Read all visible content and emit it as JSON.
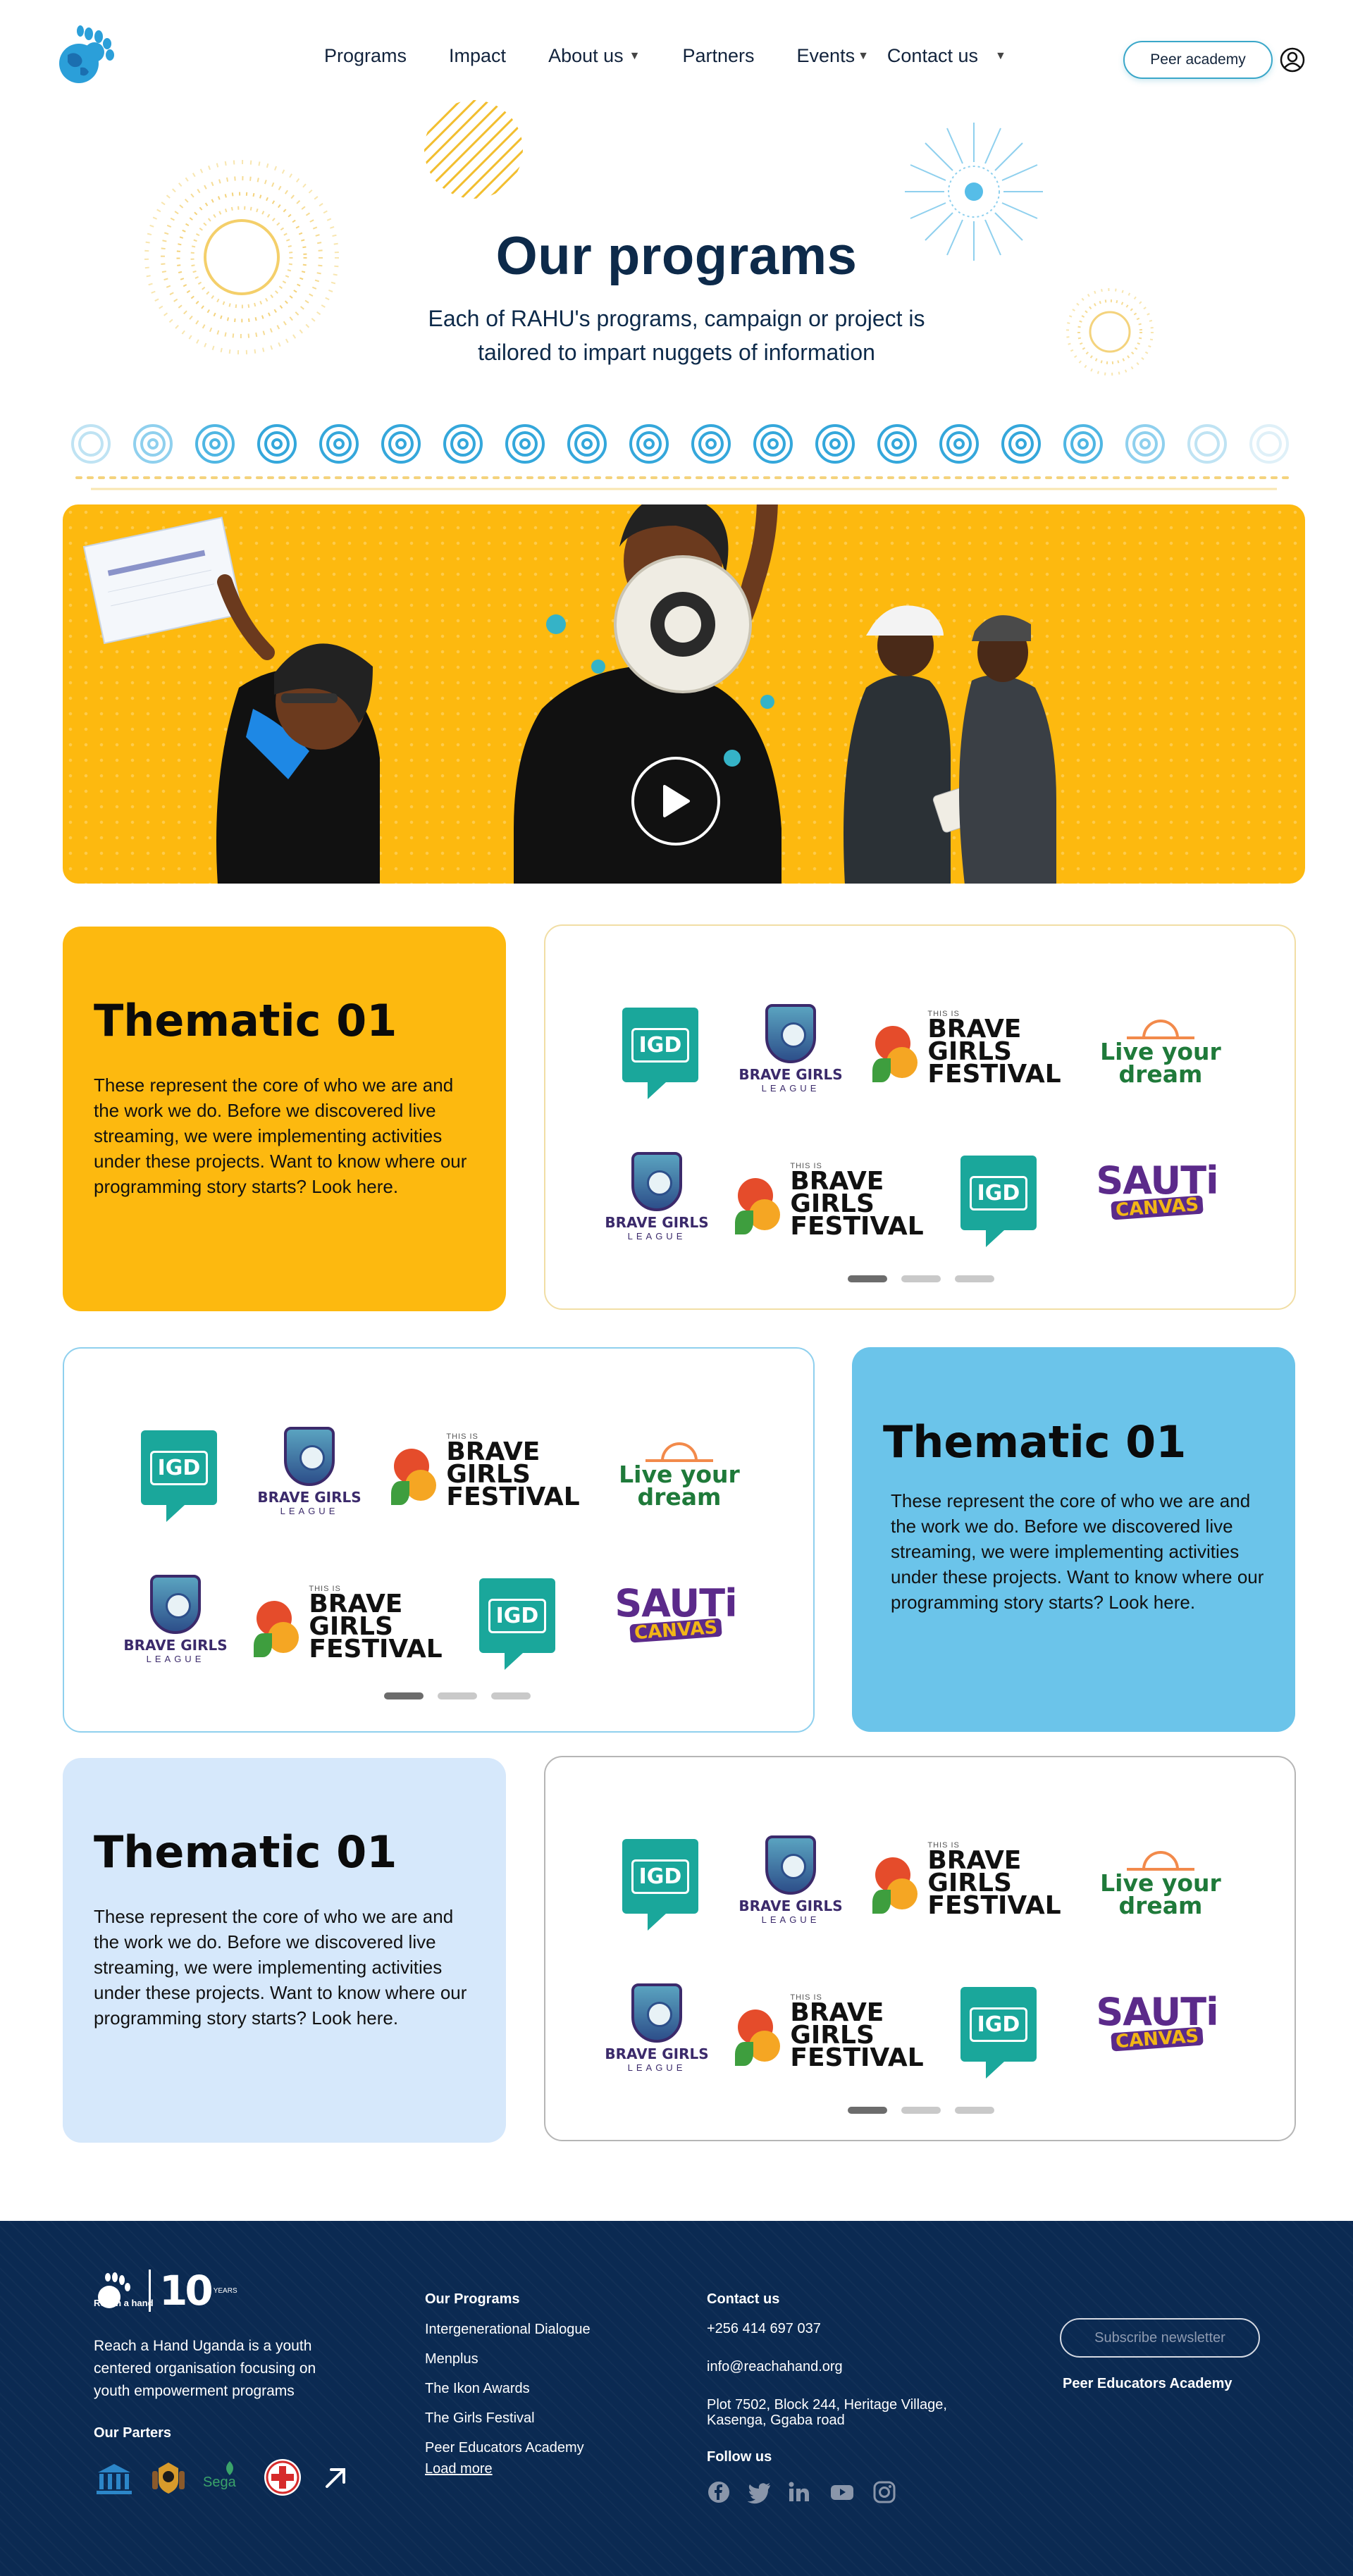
{
  "nav": {
    "items": [
      {
        "label": "Programs",
        "dropdown": false
      },
      {
        "label": "Impact",
        "dropdown": false
      },
      {
        "label": "About us",
        "dropdown": true
      },
      {
        "label": "Partners",
        "dropdown": false
      },
      {
        "label": "Events",
        "dropdown": true
      },
      {
        "label": "Contact us",
        "dropdown": true
      }
    ],
    "peer_button": "Peer academy",
    "logo_icon": "hand-globe-icon",
    "user_icon": "user-icon"
  },
  "hero": {
    "title": "Our programs",
    "subtitle": "Each of RAHU's programs, campaign or project is tailored to impart nuggets of information",
    "play_icon": "play-icon"
  },
  "sections": [
    {
      "title": "Thematic 01",
      "text": "These represent the core of who we are and the work we do. Before we discovered live streaming, we were implementing activities under these projects. Want to know where our programming story starts? Look here.",
      "color": "#fdb90f"
    },
    {
      "title": "Thematic 01",
      "text": "These represent the core of who we are and the work we do. Before we discovered live streaming, we were implementing activities under these projects. Want to know where our programming story starts? Look here.",
      "color": "#6bc4ea"
    },
    {
      "title": "Thematic 01",
      "text": "These represent the core of who we are and the work we do. Before we discovered live streaming, we were implementing activities under these projects. Want to know where our programming story starts? Look here.",
      "color": "#d6e8fb"
    }
  ],
  "logos": {
    "igd": "IGD",
    "bgl_line1": "BRAVE GIRLS",
    "bgl_line2": "LEAGUE",
    "bgf_small": "THIS IS",
    "bgf_l1": "BRAVE",
    "bgf_l2": "GIRLS",
    "bgf_l3": "FESTIVAL",
    "lyd_l1": "Live your",
    "lyd_l2": "dream",
    "sauti_l1": "SAUTi",
    "sauti_l2": "CANVAS"
  },
  "carousel": {
    "pages": 3,
    "active": 1
  },
  "footer": {
    "about": "Reach a Hand Uganda is a youth centered organisation focusing on youth empowerment programs",
    "logo_text": "Reach a hand",
    "anniversary": "10",
    "anniversary_tag": "YEARS",
    "partners_heading": "Our Parters",
    "programs_heading": "Our Programs",
    "programs": [
      "Intergenerational Dialogue",
      "Menplus",
      "The Ikon Awards",
      "The Girls Festival",
      "Peer Educators Academy"
    ],
    "load_more": "Load more",
    "contact_heading": "Contact us",
    "phone": "+256 414 697 037",
    "email": "info@reachahand.org",
    "address_l1": "Plot 7502, Block 244, Heritage Village,",
    "address_l2": "Kasenga, Ggaba road",
    "follow_heading": "Follow us",
    "subscribe": "Subscribe newsletter",
    "peer_link": "Peer Educators Academy",
    "social_icons": [
      "facebook-icon",
      "twitter-icon",
      "linkedin-icon",
      "youtube-icon",
      "instagram-icon"
    ],
    "partner_icons": [
      "unesco-icon",
      "uganda-coat-of-arms-icon",
      "sega-icon",
      "red-cross-icon",
      "arrow-up-right-icon"
    ]
  }
}
